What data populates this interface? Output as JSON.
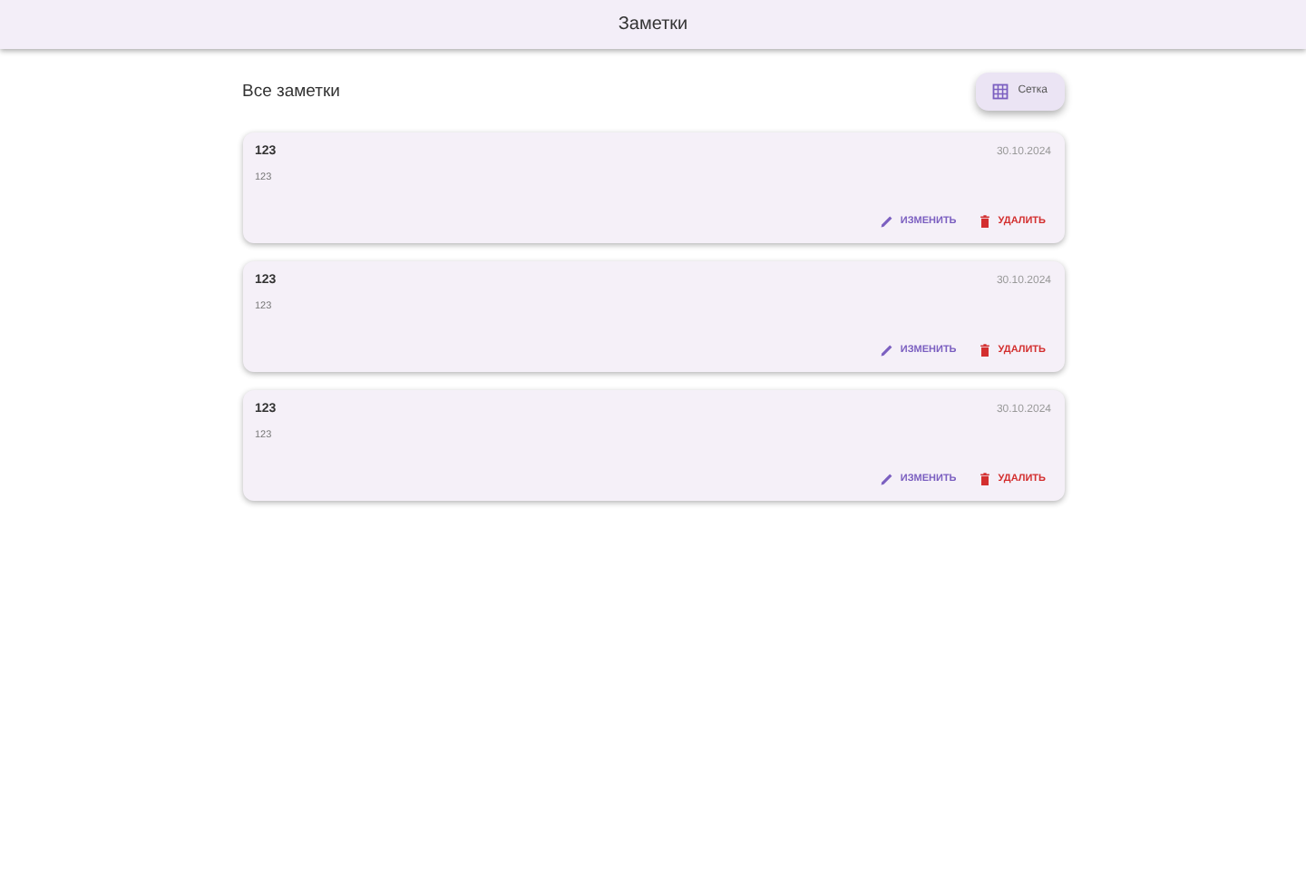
{
  "app_bar": {
    "title": "Заметки"
  },
  "header": {
    "title": "Все заметки",
    "view_button": "Сетка"
  },
  "notes": [
    {
      "title": "123",
      "date": "30.10.2024",
      "body": "123",
      "edit": "ИЗМЕНИТЬ",
      "delete": "УДАЛИТЬ"
    },
    {
      "title": "123",
      "date": "30.10.2024",
      "body": "123",
      "edit": "ИЗМЕНИТЬ",
      "delete": "УДАЛИТЬ"
    },
    {
      "title": "123",
      "date": "30.10.2024",
      "body": "123",
      "edit": "ИЗМЕНИТЬ",
      "delete": "УДАЛИТЬ"
    }
  ]
}
